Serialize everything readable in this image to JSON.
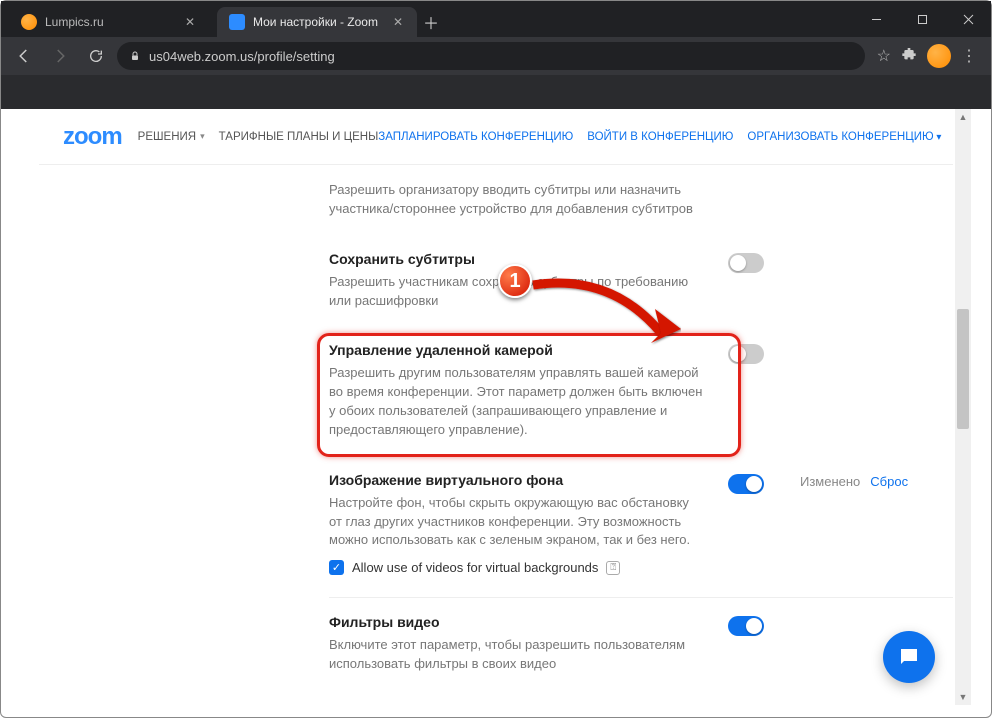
{
  "browser": {
    "tabs": [
      {
        "title": "Lumpics.ru",
        "favicon_color": "#ff8c00",
        "active": false
      },
      {
        "title": "Мои настройки - Zoom",
        "favicon_color": "#2D8CFF",
        "active": true
      }
    ],
    "url": "us04web.zoom.us/profile/setting"
  },
  "header": {
    "logo": "zoom",
    "left_nav": [
      {
        "label": "РЕШЕНИЯ",
        "dropdown": true
      },
      {
        "label": "ТАРИФНЫЕ ПЛАНЫ И ЦЕНЫ",
        "dropdown": false
      }
    ],
    "right_nav": [
      {
        "label": "ЗАПЛАНИРОВАТЬ КОНФЕРЕНЦИЮ",
        "blue": true
      },
      {
        "label": "ВОЙТИ В КОНФЕРЕНЦИЮ",
        "blue": true
      },
      {
        "label": "ОРГАНИЗОВАТЬ КОНФЕРЕНЦИЮ",
        "blue": true,
        "dropdown": true
      }
    ]
  },
  "settings": [
    {
      "title": "",
      "desc": "Разрешить организатору вводить субтитры или назначить участника/стороннее устройство для добавления субтитров",
      "toggle": null
    },
    {
      "title": "Сохранить субтитры",
      "desc": "Разрешить участникам сохранять субтитры по требованию или расшифровки",
      "toggle": false
    },
    {
      "title": "Управление удаленной камерой",
      "desc": "Разрешить другим пользователям управлять вашей камерой во время конференции. Этот параметр должен быть включен у обоих пользователей (запрашивающего управление и предоставляющего управление).",
      "toggle": false,
      "highlighted": true
    },
    {
      "title": "Изображение виртуального фона",
      "desc": "Настройте фон, чтобы скрыть окружающую вас обстановку от глаз других участников конференции. Эту возможность можно использовать как с зеленым экраном, так и без него.",
      "toggle": true,
      "changed_label": "Изменено",
      "reset_label": "Сброс",
      "checkbox": {
        "checked": true,
        "label": "Allow use of videos for virtual backgrounds"
      }
    },
    {
      "title": "Фильтры видео",
      "desc": "Включите этот параметр, чтобы разрешить пользователям использовать фильтры в своих видео",
      "toggle": true
    }
  ],
  "callout_number": "1"
}
